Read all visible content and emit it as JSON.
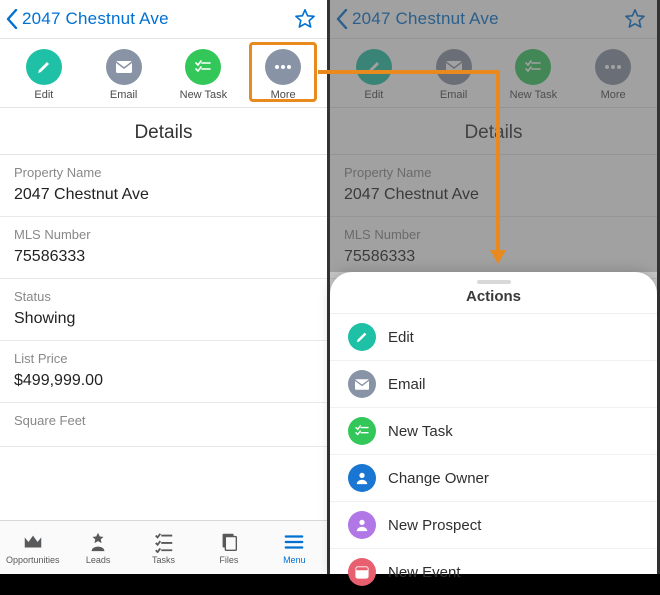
{
  "header": {
    "title": "2047 Chestnut Ave"
  },
  "actionbar": {
    "edit": "Edit",
    "email": "Email",
    "new_task": "New Task",
    "more": "More"
  },
  "details_title": "Details",
  "fields": {
    "property_name": {
      "label": "Property Name",
      "value": "2047 Chestnut Ave"
    },
    "mls_number": {
      "label": "MLS Number",
      "value": "75586333"
    },
    "status": {
      "label": "Status",
      "value": "Showing"
    },
    "list_price": {
      "label": "List Price",
      "value": "$499,999.00"
    },
    "square_feet": {
      "label": "Square Feet",
      "value": ""
    }
  },
  "tabs": {
    "opportunities": "Opportunities",
    "leads": "Leads",
    "tasks": "Tasks",
    "files": "Files",
    "menu": "Menu"
  },
  "sheet": {
    "title": "Actions",
    "edit": "Edit",
    "email": "Email",
    "new_task": "New Task",
    "change_owner": "Change Owner",
    "new_prospect": "New Prospect",
    "new_event": "New Event"
  }
}
